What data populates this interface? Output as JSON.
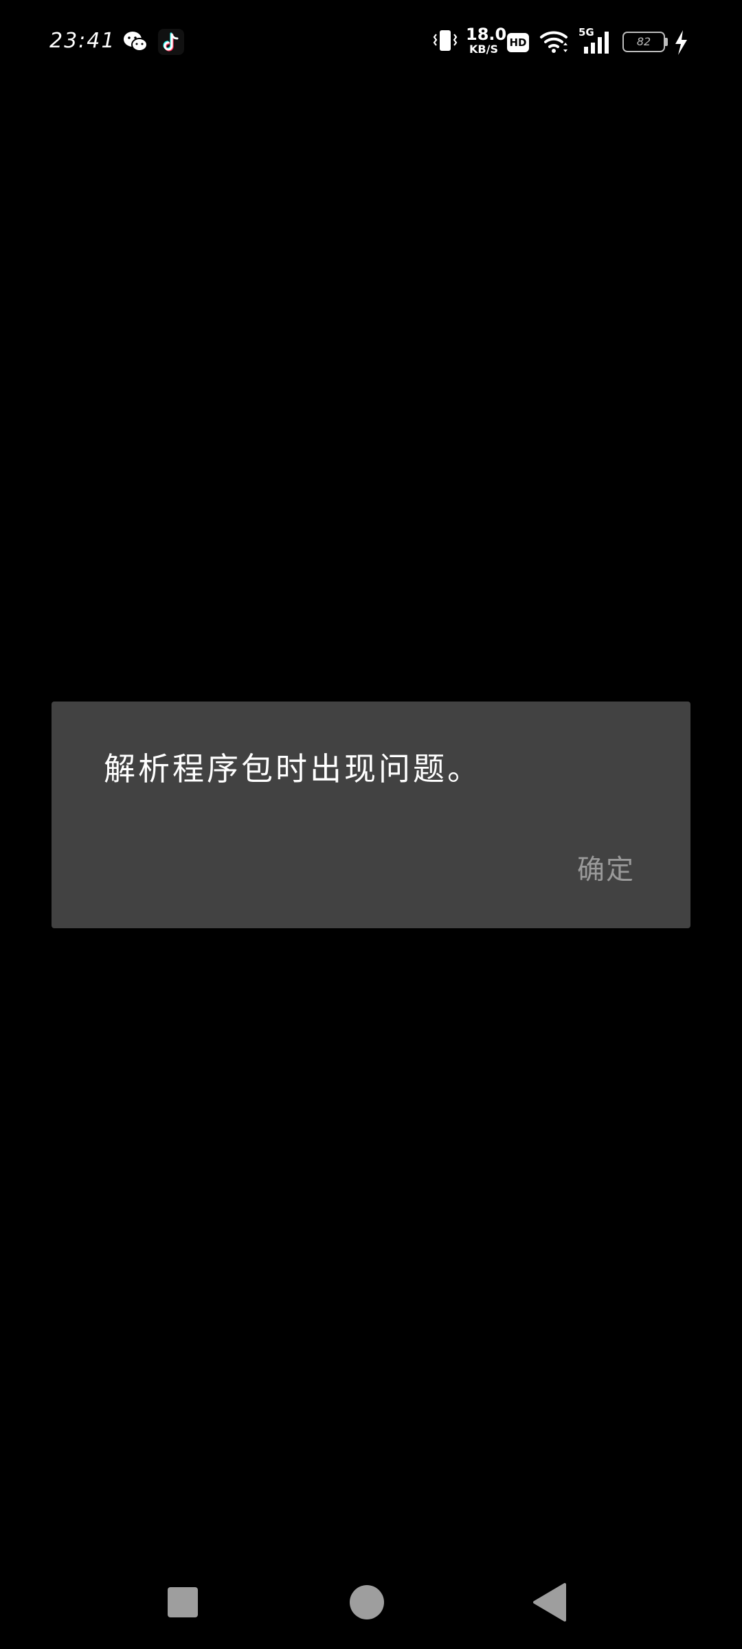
{
  "status_bar": {
    "time": "23:41",
    "notification_icons": [
      "wechat-icon",
      "tiktok-icon"
    ],
    "net_speed_value": "18.0",
    "net_speed_unit": "KB/S",
    "hd_label": "HD",
    "network_type": "5G",
    "battery_level": "82",
    "charging": true
  },
  "dialog": {
    "message": "解析程序包时出现问题。",
    "confirm_label": "确定"
  },
  "nav_bar": {
    "buttons": [
      "recents",
      "home",
      "back"
    ]
  },
  "colors": {
    "background": "#000000",
    "dialog_background": "#424242",
    "message_text": "#ffffff",
    "button_text": "#9a9a9a",
    "nav_icon": "#9e9e9e"
  }
}
